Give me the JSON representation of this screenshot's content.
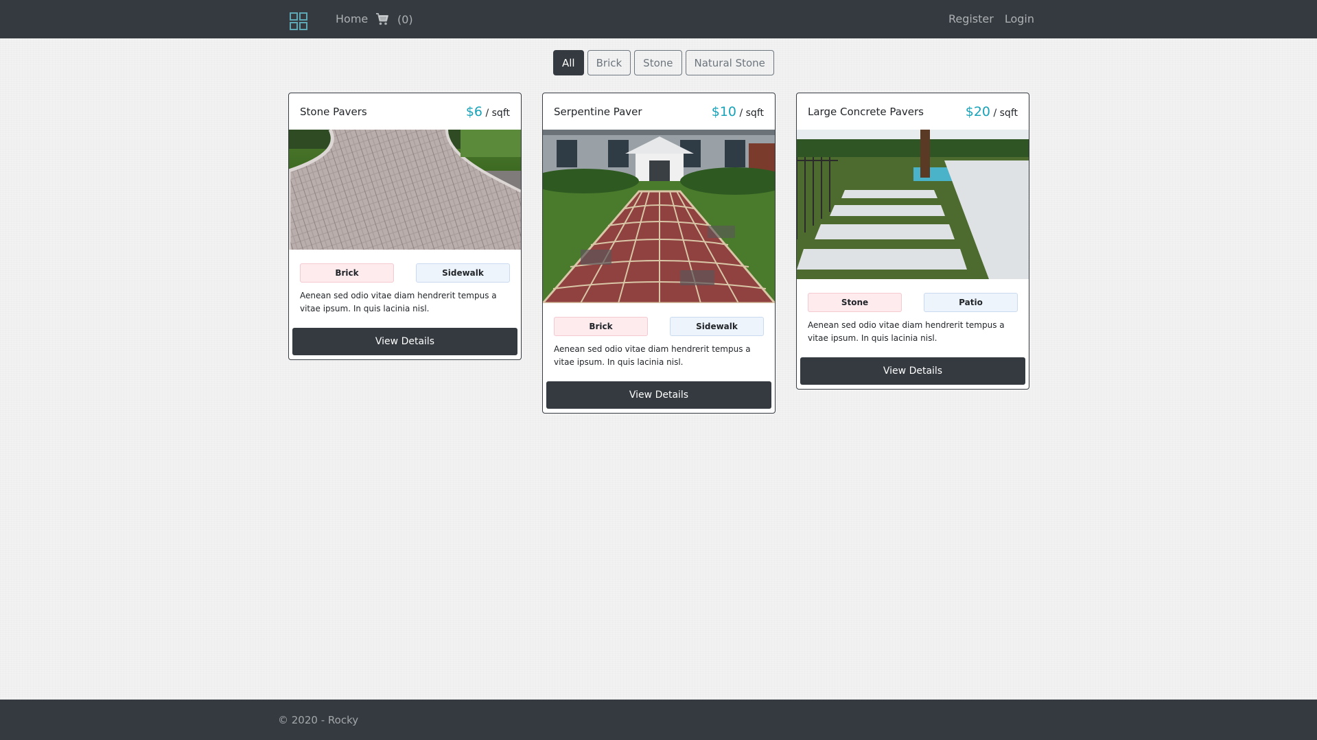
{
  "navbar": {
    "brand_icon": "grid-icon",
    "home_label": "Home",
    "cart_icon": "cart-icon",
    "cart_count": "(0)",
    "register_label": "Register",
    "login_label": "Login"
  },
  "filters": [
    "All",
    "Brick",
    "Stone",
    "Natural Stone"
  ],
  "active_filter": "All",
  "products": [
    {
      "title": "Stone Pavers",
      "price": "$6",
      "unit": "/ sqft",
      "tags": [
        "Brick",
        "Sidewalk"
      ],
      "description": "Aenean sed odio vitae diam hendrerit tempus a vitae ipsum. In quis lacinia nisl.",
      "button": "View Details"
    },
    {
      "title": "Serpentine Paver",
      "price": "$10",
      "unit": "/ sqft",
      "tags": [
        "Brick",
        "Sidewalk"
      ],
      "description": "Aenean sed odio vitae diam hendrerit tempus a vitae ipsum. In quis lacinia nisl.",
      "button": "View Details"
    },
    {
      "title": "Large Concrete Pavers",
      "price": "$20",
      "unit": "/ sqft",
      "tags": [
        "Stone",
        "Patio"
      ],
      "description": "Aenean sed odio vitae diam hendrerit tempus a vitae ipsum. In quis lacinia nisl.",
      "button": "View Details"
    }
  ],
  "colors": {
    "navbar_bg": "#343a40",
    "price_accent": "#17a2b8",
    "brand_icon": "#5fa8b6"
  },
  "footer": {
    "text": "© 2020 - Rocky"
  }
}
